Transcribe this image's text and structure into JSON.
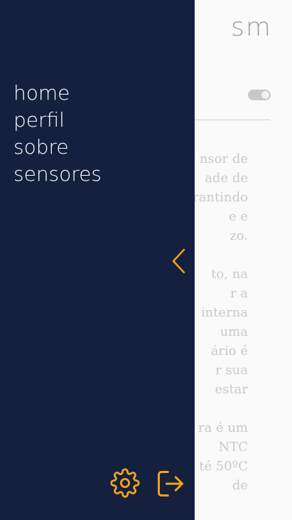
{
  "brand": "sm",
  "drawer": {
    "menu": [
      "home",
      "perfil",
      "sobre",
      "sensores"
    ],
    "collapse_icon": "chevron-left-icon",
    "footer_icons": [
      "gear-icon",
      "logout-icon"
    ]
  },
  "background_text": [
    [
      "nsor de",
      "ade de",
      "rantindo",
      "e e",
      "zo."
    ],
    [
      "to, na",
      "r a",
      "interna",
      "uma",
      "ário é",
      "r sua",
      "estar"
    ],
    [
      "ra é um",
      "NTC",
      "té 50ºC",
      "de"
    ]
  ],
  "colors": {
    "drawer_bg": "#14203e",
    "accent": "#f5a31a",
    "menu_text": "#ffffff"
  }
}
